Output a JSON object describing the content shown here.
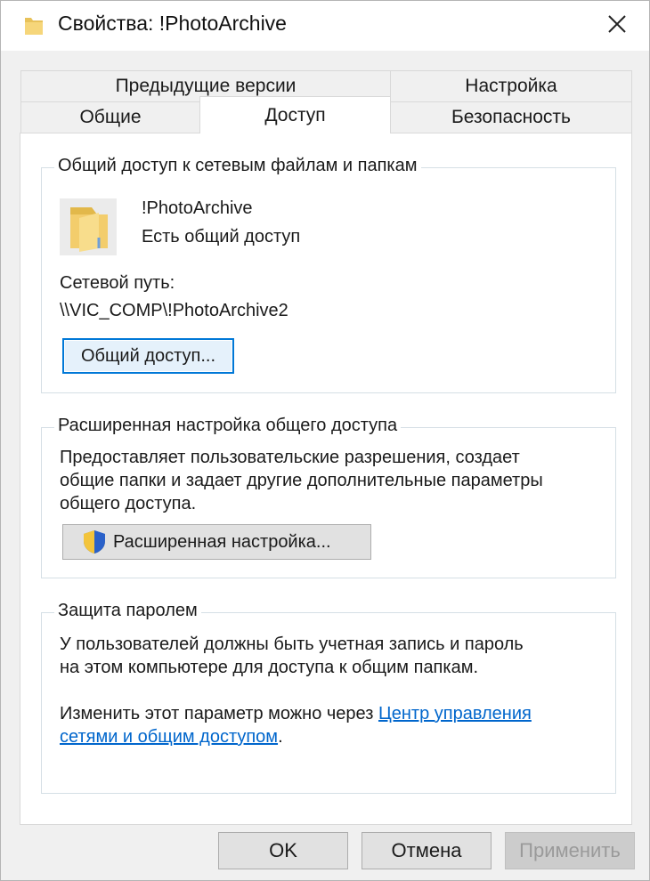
{
  "window": {
    "title": "Свойства: !PhotoArchive",
    "close_glyph": "✕"
  },
  "tabs": {
    "row_back": [
      "Предыдущие версии",
      "Настройка"
    ],
    "row_front": [
      "Общие",
      "Доступ",
      "Безопасность"
    ],
    "active": "Доступ"
  },
  "network_sharing": {
    "legend": "Общий доступ к сетевым файлам и папкам",
    "folder_name": "!PhotoArchive",
    "status": "Есть общий доступ",
    "path_label": "Сетевой путь:",
    "path_value": "\\\\VIC_COMP\\!PhotoArchive2",
    "share_button": "Общий доступ..."
  },
  "advanced_sharing": {
    "legend": "Расширенная настройка общего доступа",
    "description": [
      "Предоставляет пользовательские разрешения, создает",
      "общие папки и задает другие дополнительные параметры",
      "общего доступа."
    ],
    "button": "Расширенная настройка..."
  },
  "password_protection": {
    "legend": "Защита паролем",
    "description": [
      "У пользователей должны быть учетная запись и пароль",
      "на этом компьютере для доступа к общим папкам."
    ],
    "change_prefix": "Изменить этот параметр можно через",
    "link_line1": "Центр управления",
    "link_line2": "сетями и общим доступом",
    "link_suffix": "."
  },
  "buttons": {
    "ok": "OK",
    "cancel": "Отмена",
    "apply": "Применить"
  },
  "colors": {
    "accent": "#0078d7",
    "link": "#0066cc",
    "folder": "#e8c25a"
  }
}
